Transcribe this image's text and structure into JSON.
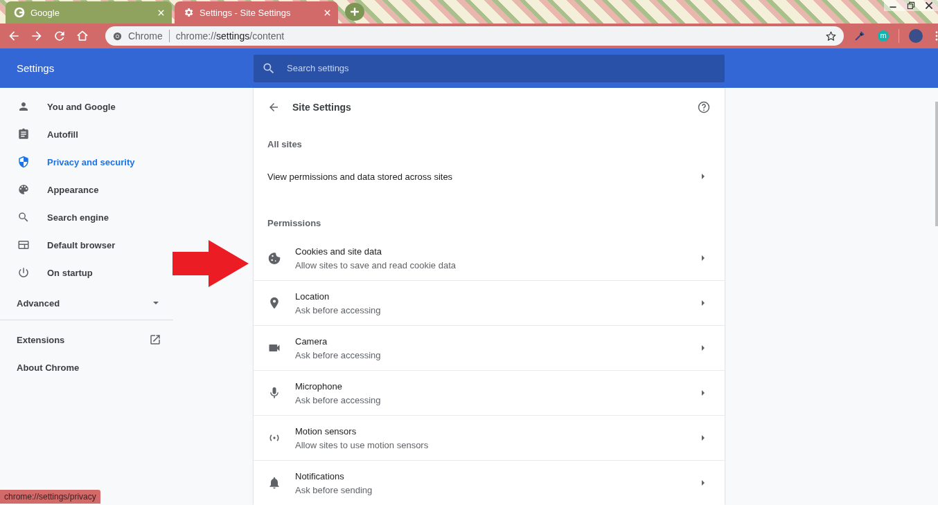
{
  "tabs": [
    {
      "title": "Google",
      "kind": "google",
      "selected": false
    },
    {
      "title": "Settings - Site Settings",
      "kind": "gear",
      "selected": true
    }
  ],
  "omnibox": {
    "chip": "Chrome",
    "scheme": "chrome://",
    "host": "settings",
    "path": "/content"
  },
  "profile": {
    "initial": "m"
  },
  "header": {
    "title": "Settings",
    "search_placeholder": "Search settings"
  },
  "sidebar": {
    "items": [
      {
        "label": "You and Google",
        "kind": "person",
        "selected": false
      },
      {
        "label": "Autofill",
        "kind": "clipboard",
        "selected": false
      },
      {
        "label": "Privacy and security",
        "kind": "shield",
        "selected": true
      },
      {
        "label": "Appearance",
        "kind": "palette",
        "selected": false
      },
      {
        "label": "Search engine",
        "kind": "search",
        "selected": false
      },
      {
        "label": "Default browser",
        "kind": "browser",
        "selected": false
      },
      {
        "label": "On startup",
        "kind": "power",
        "selected": false
      }
    ],
    "advanced": {
      "label": "Advanced",
      "expanded": false
    },
    "links": [
      {
        "label": "Extensions",
        "external": true
      },
      {
        "label": "About Chrome",
        "external": false
      }
    ]
  },
  "page": {
    "title": "Site Settings",
    "all_sites_heading": "All sites",
    "all_sites_row": "View permissions and data stored across sites",
    "permissions_heading": "Permissions",
    "permissions": [
      {
        "title": "Cookies and site data",
        "subtitle": "Allow sites to save and read cookie data",
        "kind": "cookie"
      },
      {
        "title": "Location",
        "subtitle": "Ask before accessing",
        "kind": "location"
      },
      {
        "title": "Camera",
        "subtitle": "Ask before accessing",
        "kind": "camera"
      },
      {
        "title": "Microphone",
        "subtitle": "Ask before accessing",
        "kind": "microphone"
      },
      {
        "title": "Motion sensors",
        "subtitle": "Allow sites to use motion sensors",
        "kind": "motion"
      },
      {
        "title": "Notifications",
        "subtitle": "Ask before sending",
        "kind": "bell"
      }
    ]
  },
  "status_bubble": "chrome://settings/privacy"
}
